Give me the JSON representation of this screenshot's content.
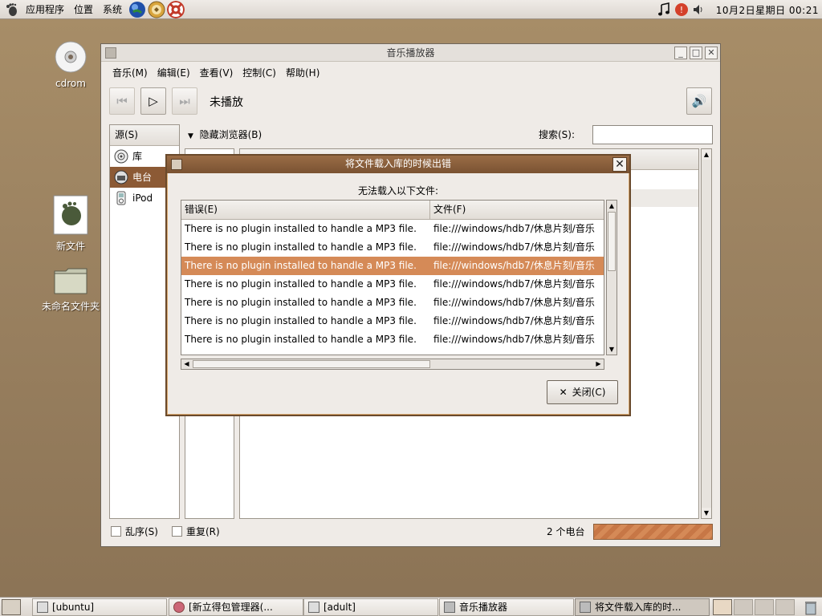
{
  "top_panel": {
    "menus": [
      "应用程序",
      "位置",
      "系统"
    ],
    "clock": "10月2日星期日 00:21"
  },
  "desktop": {
    "icons": [
      {
        "label": "cdrom"
      },
      {
        "label": "新文件"
      },
      {
        "label": "未命名文件夹"
      }
    ]
  },
  "main_window": {
    "title": "音乐播放器",
    "menu": [
      "音乐(M)",
      "编辑(E)",
      "查看(V)",
      "控制(C)",
      "帮助(H)"
    ],
    "now_playing": "未播放",
    "source_header": "源(S)",
    "sources": [
      {
        "label": "库",
        "selected": false
      },
      {
        "label": "电台",
        "selected": true
      },
      {
        "label": "iPod",
        "selected": false
      }
    ],
    "browser_toggle": "隐藏浏览器(B)",
    "search_label": "搜索(S):",
    "search_value": "",
    "shuffle_label": "乱序(S)",
    "repeat_label": "重复(R)",
    "station_count": "2 个电台"
  },
  "dialog": {
    "title": "将文件载入库的时候出错",
    "message": "无法载入以下文件:",
    "columns": [
      "错误(E)",
      "文件(F)"
    ],
    "rows": [
      {
        "error": "There is no plugin installed to handle a MP3 file.",
        "file": "file:///windows/hdb7/休息片刻/音乐",
        "selected": false
      },
      {
        "error": "There is no plugin installed to handle a MP3 file.",
        "file": "file:///windows/hdb7/休息片刻/音乐",
        "selected": false
      },
      {
        "error": "There is no plugin installed to handle a MP3 file.",
        "file": "file:///windows/hdb7/休息片刻/音乐",
        "selected": true
      },
      {
        "error": "There is no plugin installed to handle a MP3 file.",
        "file": "file:///windows/hdb7/休息片刻/音乐",
        "selected": false
      },
      {
        "error": "There is no plugin installed to handle a MP3 file.",
        "file": "file:///windows/hdb7/休息片刻/音乐",
        "selected": false
      },
      {
        "error": "There is no plugin installed to handle a MP3 file.",
        "file": "file:///windows/hdb7/休息片刻/音乐",
        "selected": false
      },
      {
        "error": "There is no plugin installed to handle a MP3 file.",
        "file": "file:///windows/hdb7/休息片刻/音乐",
        "selected": false
      }
    ],
    "close_label": "关闭(C)"
  },
  "taskbar": {
    "tasks": [
      {
        "label": "[ubuntu]",
        "active": false
      },
      {
        "label": "[新立得包管理器(...",
        "active": false
      },
      {
        "label": "[adult]",
        "active": false
      },
      {
        "label": "音乐播放器",
        "active": false
      },
      {
        "label": "将文件载入库的时...",
        "active": true
      }
    ]
  },
  "colors": {
    "selection": "#d58a57",
    "source_selected": "#8c5a35",
    "dialog_title": "#7a5232"
  }
}
